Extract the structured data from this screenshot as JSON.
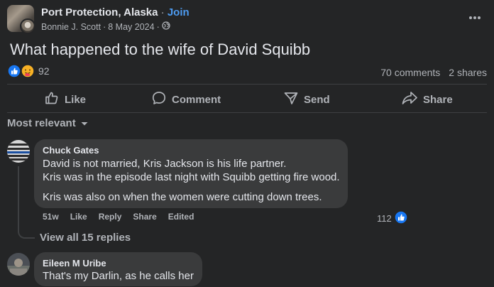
{
  "post": {
    "group_name": "Port Protection, Alaska",
    "separator": "·",
    "join_label": "Join",
    "author": "Bonnie J. Scott",
    "date": "8 May 2024",
    "privacy_icon": "globe-icon",
    "text": "What happened to the wife of David Squibb",
    "reaction_count": "92",
    "comments_count": "70 comments",
    "shares_count": "2 shares"
  },
  "actions": {
    "like": "Like",
    "comment": "Comment",
    "send": "Send",
    "share": "Share"
  },
  "sort_label": "Most relevant",
  "comments": [
    {
      "author": "Chuck Gates",
      "lines": [
        "David is not married, Kris Jackson is his life partner.",
        "Kris was in the episode last night with Squibb getting fire wood.",
        "Kris was also on when the women were cutting down trees."
      ],
      "age": "51w",
      "like_label": "Like",
      "reply_label": "Reply",
      "share_label": "Share",
      "edited_label": "Edited",
      "likes": "112",
      "view_replies": "View all 15 replies"
    },
    {
      "author": "Eileen M Uribe",
      "lines": [
        "That's my Darlin, as he calls her"
      ]
    }
  ],
  "colors": {
    "background": "#242526",
    "bubble": "#3a3b3c",
    "join": "#4d9bf0",
    "like_blue": "#1877f2"
  }
}
